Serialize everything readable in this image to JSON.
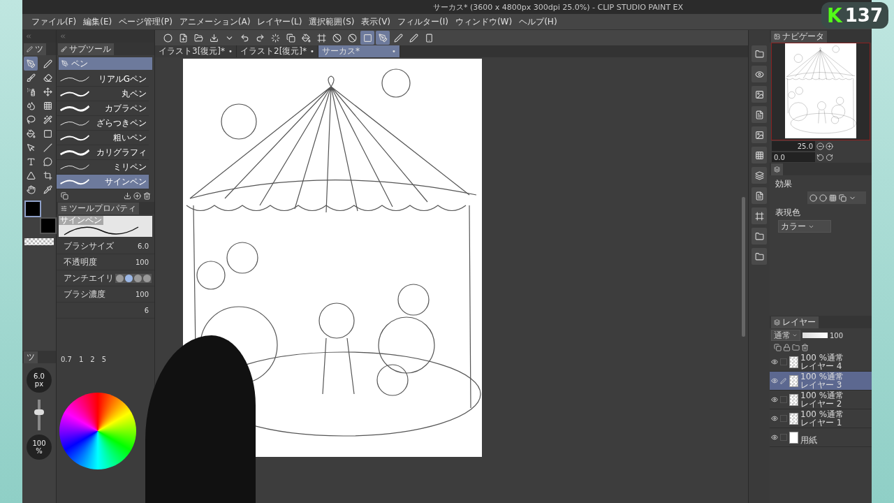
{
  "window": {
    "title": "サーカス* (3600 x 4800px 300dpi 25.0%) - CLIP STUDIO PAINT EX"
  },
  "menu": [
    "ファイル(F)",
    "編集(E)",
    "ページ管理(P)",
    "アニメーション(A)",
    "レイヤー(L)",
    "選択範囲(S)",
    "表示(V)",
    "フィルター(I)",
    "ウィンドウ(W)",
    "ヘルプ(H)"
  ],
  "toolbar": {
    "buttons": [
      {
        "selected": false
      },
      {
        "selected": false
      },
      {
        "selected": false
      },
      {
        "selected": false
      },
      {
        "selected": false
      },
      {
        "selected": false
      },
      {
        "selected": false
      },
      {
        "selected": false
      },
      {
        "selected": false
      },
      {
        "selected": false
      },
      {
        "selected": false
      },
      {
        "selected": false
      },
      {
        "selected": false
      },
      {
        "selected": true
      },
      {
        "selected": true
      },
      {
        "selected": false
      },
      {
        "selected": false
      },
      {
        "selected": false
      }
    ]
  },
  "document_tabs": [
    {
      "label": "イラスト3[復元]*",
      "marker": "•",
      "selected": false
    },
    {
      "label": "イラスト2[復元]*",
      "marker": "•",
      "selected": false
    },
    {
      "label": "サーカス*",
      "marker": "•",
      "selected": true
    }
  ],
  "tool_palette": {
    "tab": "ツ",
    "tools": [
      {
        "selected": true
      },
      {
        "selected": false
      },
      {
        "selected": false
      },
      {
        "selected": false
      },
      {
        "selected": false
      },
      {
        "selected": false
      },
      {
        "selected": false
      },
      {
        "selected": false
      },
      {
        "selected": false
      },
      {
        "selected": false
      },
      {
        "selected": false
      },
      {
        "selected": false
      },
      {
        "selected": false
      },
      {
        "selected": false
      },
      {
        "selected": false
      },
      {
        "selected": false
      },
      {
        "selected": false
      },
      {
        "selected": false
      },
      {
        "selected": false
      },
      {
        "selected": false
      }
    ]
  },
  "subtool": {
    "tab": "サブツール",
    "group": "ペン",
    "items": [
      {
        "label": "リアルGペン",
        "selected": false
      },
      {
        "label": "丸ペン",
        "selected": false
      },
      {
        "label": "カブラペン",
        "selected": false
      },
      {
        "label": "ざらつきペン",
        "selected": false
      },
      {
        "label": "粗いペン",
        "selected": false
      },
      {
        "label": "カリグラフィ",
        "selected": false
      },
      {
        "label": "ミリペン",
        "selected": false
      },
      {
        "label": "サインペン",
        "selected": true
      }
    ]
  },
  "tool_property": {
    "tab": "ツールプロパティ",
    "preview_label": "サインペン",
    "properties": [
      {
        "label": "ブラシサイズ",
        "value": "6.0"
      },
      {
        "label": "不透明度",
        "value": "100"
      },
      {
        "label": "アンチエイリ"
      },
      {
        "label": "ブラシ濃度",
        "value": "100"
      },
      {
        "value": "6"
      }
    ]
  },
  "brush_size": {
    "tab": "ツ",
    "value": "6.0",
    "unit": "px",
    "level": 0.6,
    "sizes": [
      "0.7",
      "1",
      "2",
      "5"
    ]
  },
  "color_wheel": {
    "opacity": "100",
    "unit": "%"
  },
  "navigator": {
    "tab": "ナビゲータ",
    "zoom": "25.0",
    "rotation": "0.0"
  },
  "layer_property": {
    "effect_label": "効果",
    "color_label": "表現色",
    "color_mode": "カラー"
  },
  "layers": {
    "tab": "レイヤー",
    "blend": "通常",
    "opacity": "100",
    "rows": [
      {
        "mode": "100 %通常",
        "name": "レイヤー 4",
        "selected": false,
        "editing": false,
        "visible": true
      },
      {
        "mode": "100 %通常",
        "name": "レイヤー 3",
        "selected": true,
        "editing": true,
        "visible": true
      },
      {
        "mode": "100 %通常",
        "name": "レイヤー 2",
        "selected": false,
        "editing": false,
        "visible": true
      },
      {
        "mode": "100 %通常",
        "name": "レイヤー 1",
        "selected": false,
        "editing": false,
        "visible": true
      }
    ],
    "paper": {
      "name": "用紙",
      "visible": true,
      "editing": false
    }
  },
  "stream_badge": {
    "logo": "K",
    "count": "137"
  }
}
